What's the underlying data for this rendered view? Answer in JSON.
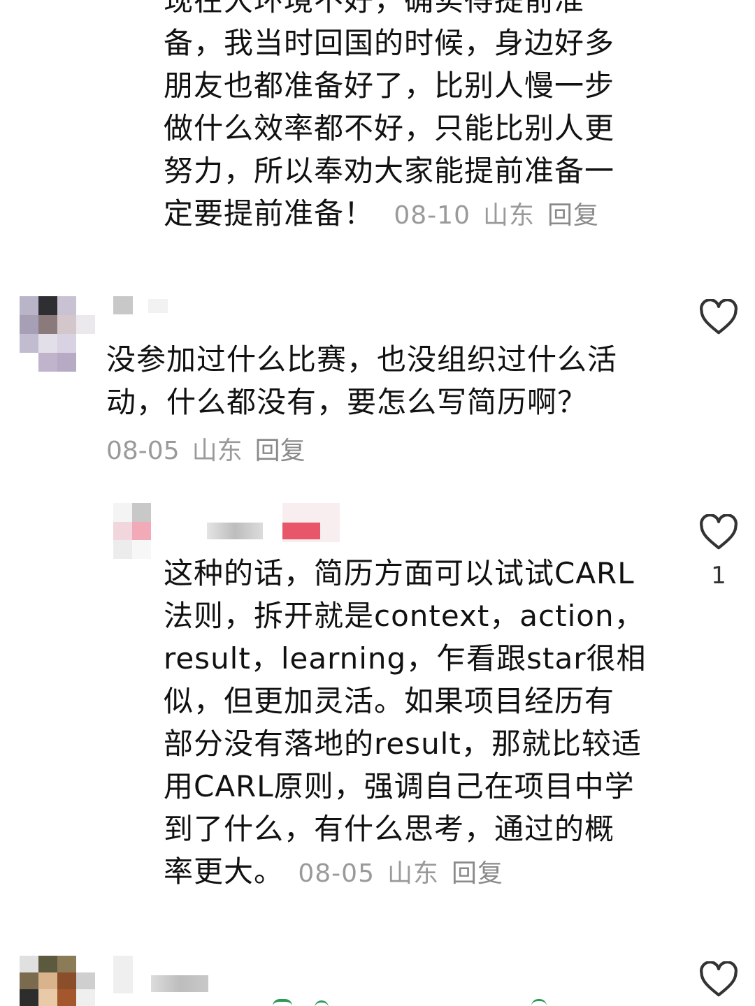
{
  "comments": [
    {
      "id": "c0-tail",
      "text": "现在大环境不好，确实得提前准备，我当时回国的时候，身边好多朋友也都准备好了，比别人慢一步做什么效率都不好，只能比别人更努力，所以奉劝大家能提前准备一定要提前准备！",
      "lines": [
        "现在大环境不好，确实得提前准",
        "备，我当时回国的时候，身边好多",
        "朋友也都准备好了，比别人慢一步",
        "做什么效率都不好，只能比别人更",
        "努力，所以奉劝大家能提前准备一",
        "定要提前准备！"
      ],
      "date": "08-10",
      "location": "山东",
      "reply_label": "回复"
    },
    {
      "id": "c1",
      "lines": [
        "没参加过什么比赛，也没组织过什么活",
        "动，什么都没有，要怎么写简历啊？"
      ],
      "date": "08-05",
      "location": "山东",
      "reply_label": "回复",
      "like_icon": "heart-outline-icon"
    },
    {
      "id": "c1-reply",
      "lines": [
        "这种的话，简历方面可以试试CARL",
        "法则，拆开就是context，action，",
        "result，learning，乍看跟star很相",
        "似，但更加灵活。如果项目经历有",
        "部分没有落地的result，那就比较适",
        "用CARL原则，强调自己在项目中学",
        "到了什么，有什么思考，通过的概",
        "率更大。"
      ],
      "date": "08-05",
      "location": "山东",
      "reply_label": "回复",
      "like_icon": "heart-outline-icon",
      "like_count": "1"
    },
    {
      "id": "c2",
      "like_icon": "heart-outline-icon"
    }
  ],
  "colors": {
    "text": "#111111",
    "meta": "#9a9a9a",
    "heart": "#333333",
    "tag_red": "#e8566a"
  }
}
